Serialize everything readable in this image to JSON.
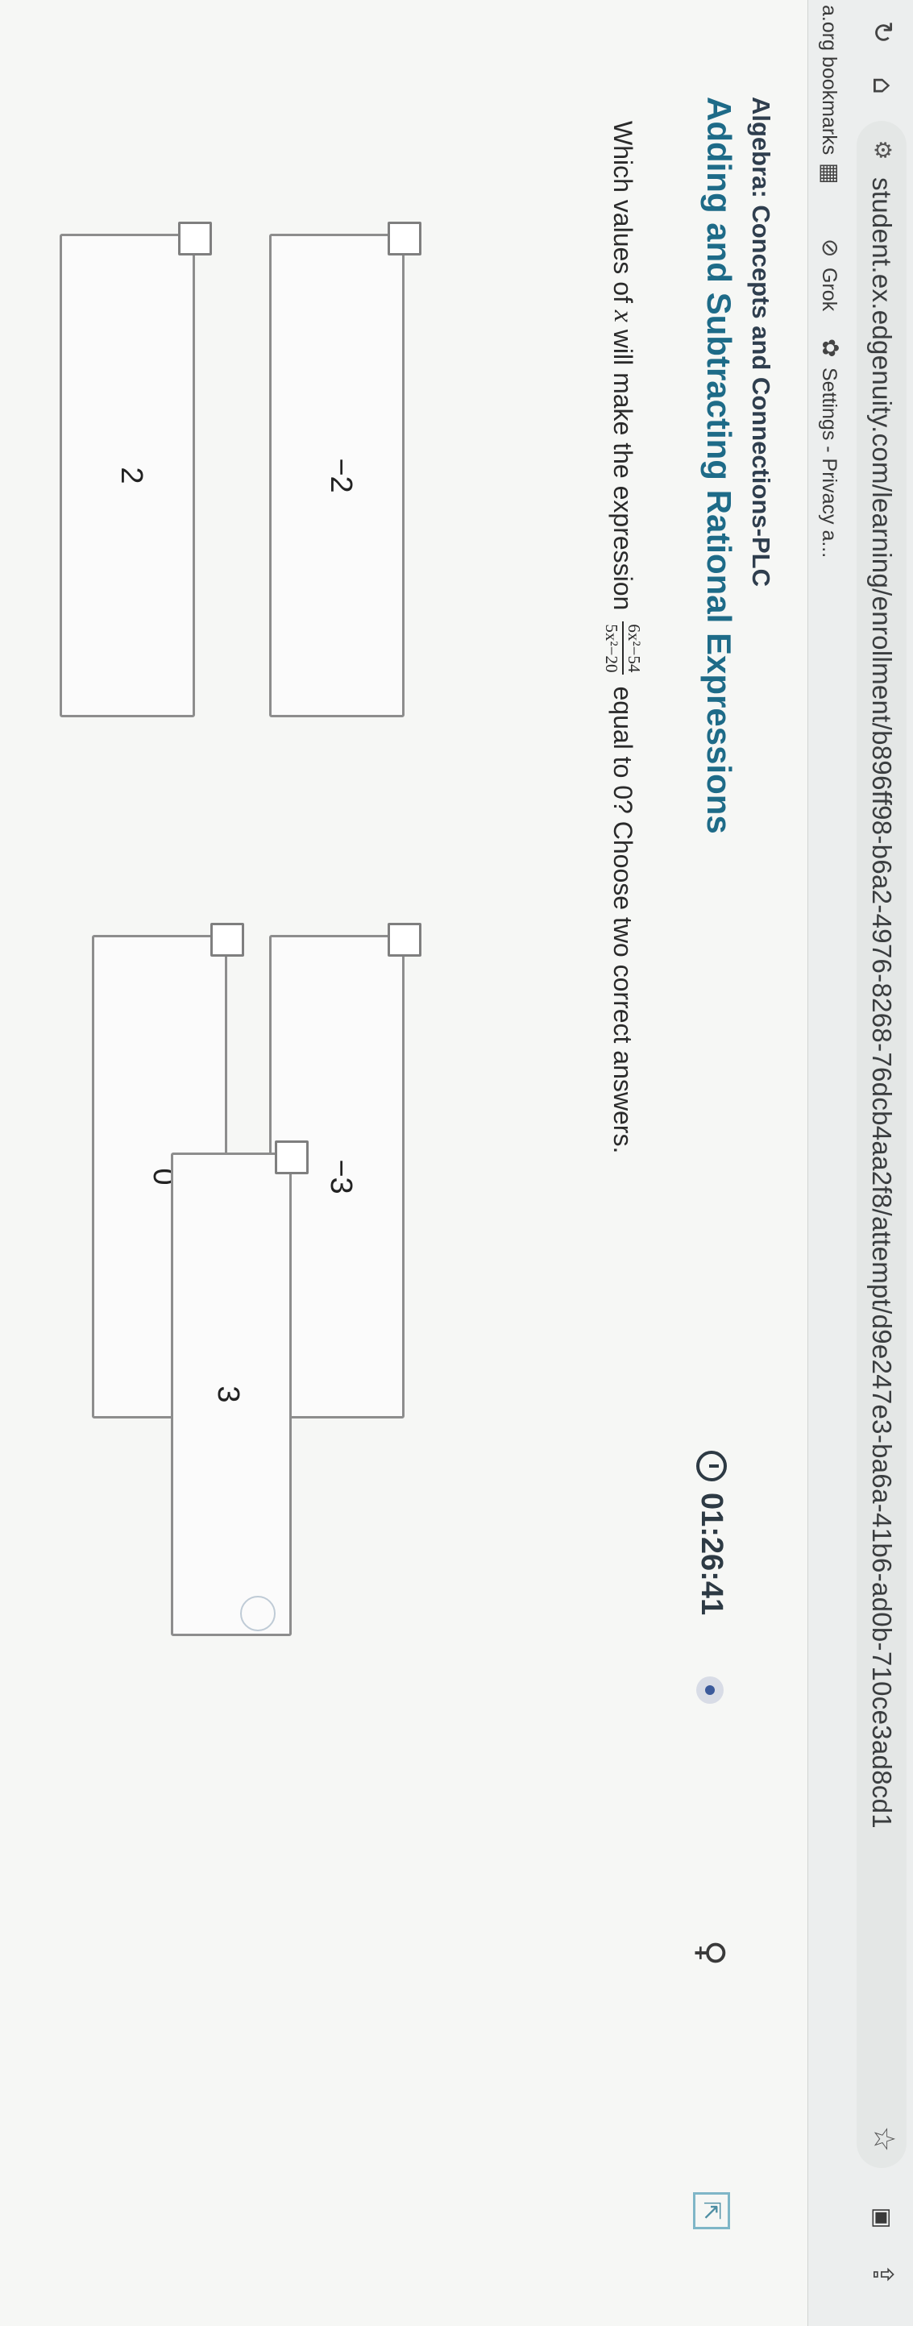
{
  "browser": {
    "url": "student.ex.edgenuity.com/learning/enrollment/b896ff98-b6a2-4976-8268-76dcb4aa2f8/attempt/d9e247e3-ba6a-41b6-ad0b-710ce3ad8cd1",
    "bookmarks": [
      {
        "label": "a.org bookmarks"
      },
      {
        "label": "Grok"
      },
      {
        "label": "Settings - Privacy a..."
      }
    ]
  },
  "header": {
    "course": "Algebra: Concepts and Connections-PLC",
    "lesson": "Adding and Subtracting Rational Expressions",
    "timer": "01:26:41"
  },
  "question": {
    "prefix": "Which values of",
    "variable": "x",
    "middle": "will make the expression",
    "numerator": "6x²−54",
    "denominator": "5x²−20",
    "suffix": "equal to 0? Choose two correct answers."
  },
  "options": [
    {
      "label": "−2"
    },
    {
      "label": "2"
    },
    {
      "label": "−3"
    },
    {
      "label": "0"
    },
    {
      "label": "3"
    }
  ],
  "icons": {
    "reload": "reload-icon",
    "home": "home-icon",
    "tune": "site-settings-icon",
    "star": "bookmark-star-icon",
    "apps": "apps-grid-icon",
    "grok": "grok-icon",
    "settings": "gear-icon",
    "timer": "clock-icon",
    "hint": "lightbulb-icon",
    "expand": "expand-icon"
  }
}
